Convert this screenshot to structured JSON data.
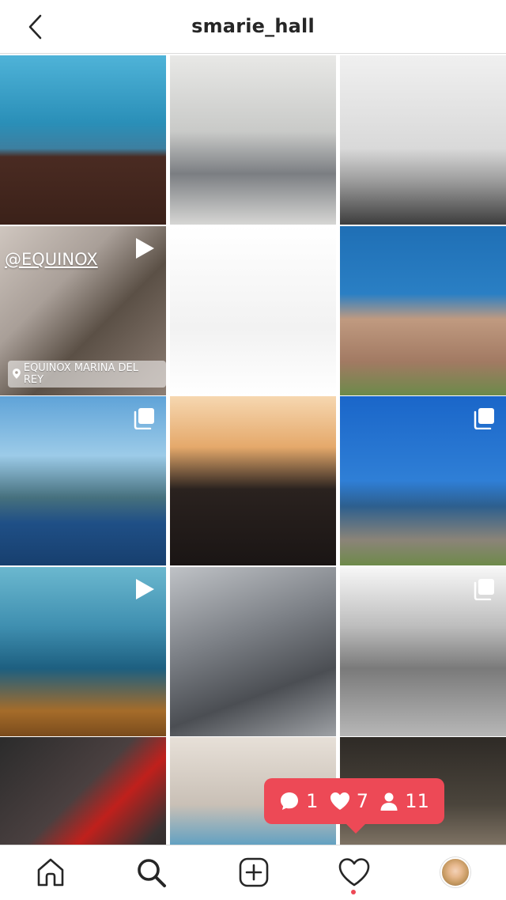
{
  "header": {
    "title": "smarie_hall",
    "back_icon": "chevron-left-icon"
  },
  "grid": {
    "tiles": [
      {
        "label": "jump-on-lava-rocks-photo",
        "badge": ""
      },
      {
        "label": "gym-lunge-photo",
        "badge": ""
      },
      {
        "label": "split-leap-bw-photo",
        "badge": ""
      },
      {
        "label": "equinox-story-video",
        "badge": "video",
        "overlay_text": "@EQUINOX",
        "location_text": "EQUINOX MARINA DEL REY"
      },
      {
        "label": "snowboarder-photo",
        "badge": ""
      },
      {
        "label": "beach-portrait-photo",
        "badge": ""
      },
      {
        "label": "snorkel-on-boat-photo",
        "badge": "carousel"
      },
      {
        "label": "fur-hood-sunset-photo",
        "badge": ""
      },
      {
        "label": "bikini-harbor-photo",
        "badge": "carousel"
      },
      {
        "label": "ocean-cliff-video",
        "badge": "video"
      },
      {
        "label": "dancers-architecture-photo",
        "badge": ""
      },
      {
        "label": "dog-on-beach-bw-photo",
        "badge": "carousel"
      },
      {
        "label": "red-outfit-marble-photo",
        "badge": ""
      },
      {
        "label": "dogs-on-bed-photo",
        "badge": ""
      },
      {
        "label": "waterfall-portrait-photo",
        "badge": ""
      }
    ]
  },
  "activity": {
    "comments": "1",
    "likes": "7",
    "follows": "11"
  },
  "tabbar": {
    "icons": [
      "home-icon",
      "search-icon",
      "add-post-icon",
      "activity-heart-icon",
      "profile-avatar"
    ]
  },
  "colors": {
    "accent": "#ed4956",
    "text": "#262626",
    "divider": "#dbdbdb"
  }
}
